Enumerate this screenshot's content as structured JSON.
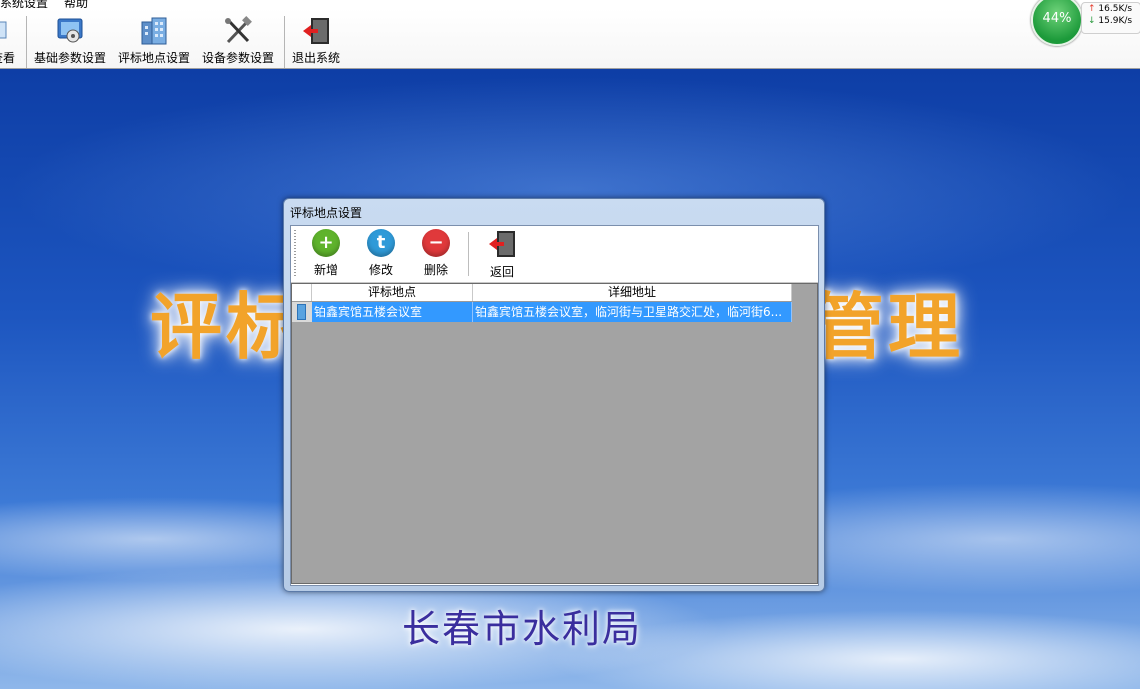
{
  "menu": {
    "items": [
      "系统设置",
      "帮助"
    ]
  },
  "toolbar": {
    "partial_label": "查看",
    "buttons": [
      {
        "label": "基础参数设置",
        "icon": "monitor-settings-icon"
      },
      {
        "label": "评标地点设置",
        "icon": "building-icon"
      },
      {
        "label": "设备参数设置",
        "icon": "tools-icon"
      },
      {
        "label": "退出系统",
        "icon": "exit-door-icon"
      }
    ]
  },
  "network": {
    "percent": "44%",
    "upload": "16.5K/s",
    "download": "15.9K/s"
  },
  "background": {
    "title_left": "评标",
    "title_right": "管理",
    "bureau": "长春市水利局"
  },
  "dialog": {
    "title": "评标地点设置",
    "buttons": [
      {
        "label": "新增",
        "icon": "add-icon",
        "color": "#5fb32c",
        "glyph": "+"
      },
      {
        "label": "修改",
        "icon": "edit-icon",
        "color": "#2f9ad8",
        "glyph": "t"
      },
      {
        "label": "删除",
        "icon": "delete-icon",
        "color": "#e0393b",
        "glyph": "−"
      },
      {
        "label": "返回",
        "icon": "return-door-icon"
      }
    ],
    "table": {
      "columns": [
        "评标地点",
        "详细地址"
      ],
      "rows": [
        [
          "铂鑫宾馆五楼会议室",
          "铂鑫宾馆五楼会议室，临河街与卫星路交汇处，临河街6..."
        ]
      ]
    }
  }
}
